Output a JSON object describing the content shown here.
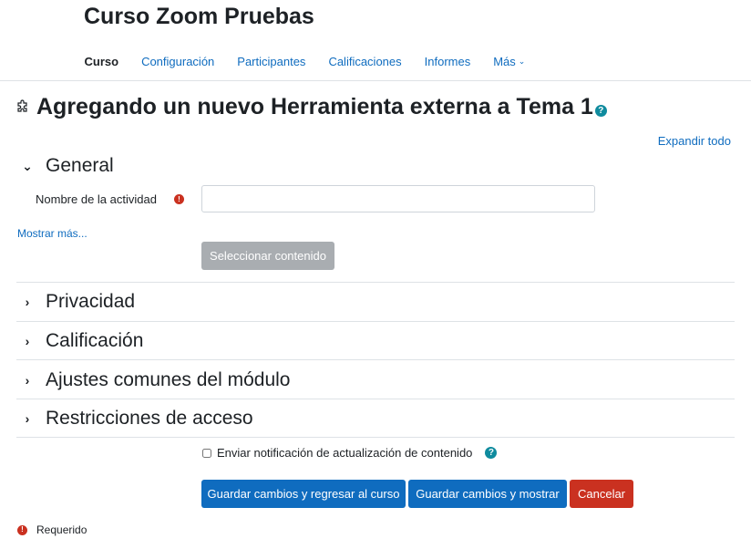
{
  "course": {
    "title": "Curso Zoom Pruebas"
  },
  "nav": {
    "items": [
      {
        "label": "Curso"
      },
      {
        "label": "Configuración"
      },
      {
        "label": "Participantes"
      },
      {
        "label": "Calificaciones"
      },
      {
        "label": "Informes"
      },
      {
        "label": "Más"
      }
    ],
    "active": "Curso"
  },
  "heading": {
    "icon": "puzzle-icon",
    "text": "Agregando un nuevo Herramienta externa a Tema 1",
    "help_glyph": "?"
  },
  "expand_all": "Expandir todo",
  "sections": {
    "general": {
      "title": "General",
      "expanded": true
    },
    "privacy": {
      "title": "Privacidad"
    },
    "grading": {
      "title": "Calificación"
    },
    "common": {
      "title": "Ajustes comunes del módulo"
    },
    "restrictions": {
      "title": "Restricciones de acceso"
    }
  },
  "form": {
    "activity_name_label": "Nombre de la actividad",
    "activity_name_value": "",
    "required_glyph": "!",
    "show_more": "Mostrar más...",
    "select_content_label": "Seleccionar contenido",
    "notify_label": "Enviar notificación de actualización de contenido",
    "notify_checked": false
  },
  "buttons": {
    "save_return": "Guardar cambios y regresar al curso",
    "save_display": "Guardar cambios y mostrar",
    "cancel": "Cancelar"
  },
  "required_note": "Requerido",
  "colors": {
    "link": "#0f6cbf",
    "primary": "#0f6cbf",
    "danger": "#ca3120",
    "help": "#0f8b9e",
    "disabled": "#a9adb1"
  }
}
